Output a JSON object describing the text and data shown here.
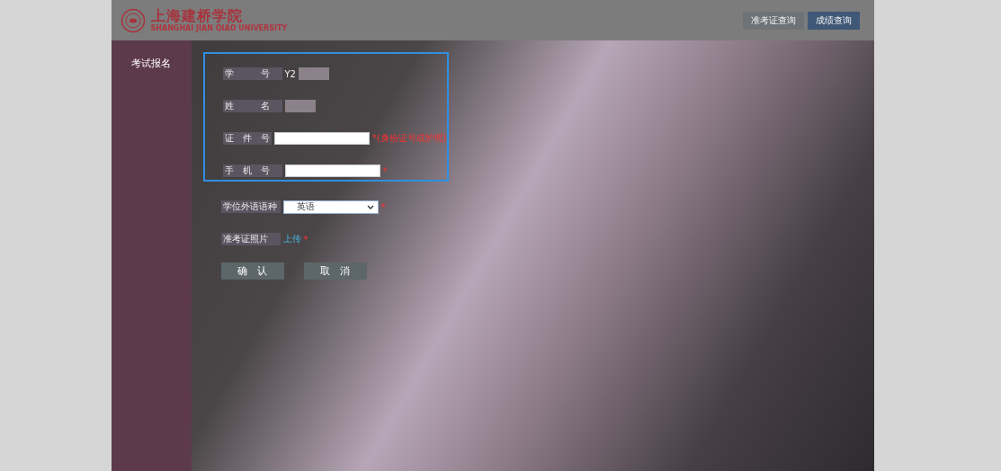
{
  "header": {
    "logo_text": "上海建桥学院",
    "logo_subtitle": "SHANGHAI JIAN QIAO UNIVERSITY",
    "nav": [
      {
        "label": "准考证查询",
        "selected": false
      },
      {
        "label": "成绩查询",
        "selected": true
      }
    ]
  },
  "sidebar": {
    "items": [
      {
        "label": "考试报名",
        "selected": true
      }
    ]
  },
  "form": {
    "fields": [
      {
        "kind": "text",
        "label": "学　　　号",
        "value": "Y2",
        "redacted": true
      },
      {
        "kind": "text",
        "label": "姓　　　名",
        "redacted": true
      },
      {
        "kind": "input",
        "label": "证　件　号",
        "hint": "*(身份证号或护照)"
      },
      {
        "kind": "input",
        "label": "手　机　号",
        "hint": "*"
      },
      {
        "kind": "select",
        "label": "学位外语语种",
        "value": "英语",
        "hint": "*"
      },
      {
        "kind": "upload",
        "label": "准考证照片",
        "link": "上传",
        "hint": "*"
      }
    ],
    "buttons": [
      "确　认",
      "取　消"
    ]
  }
}
